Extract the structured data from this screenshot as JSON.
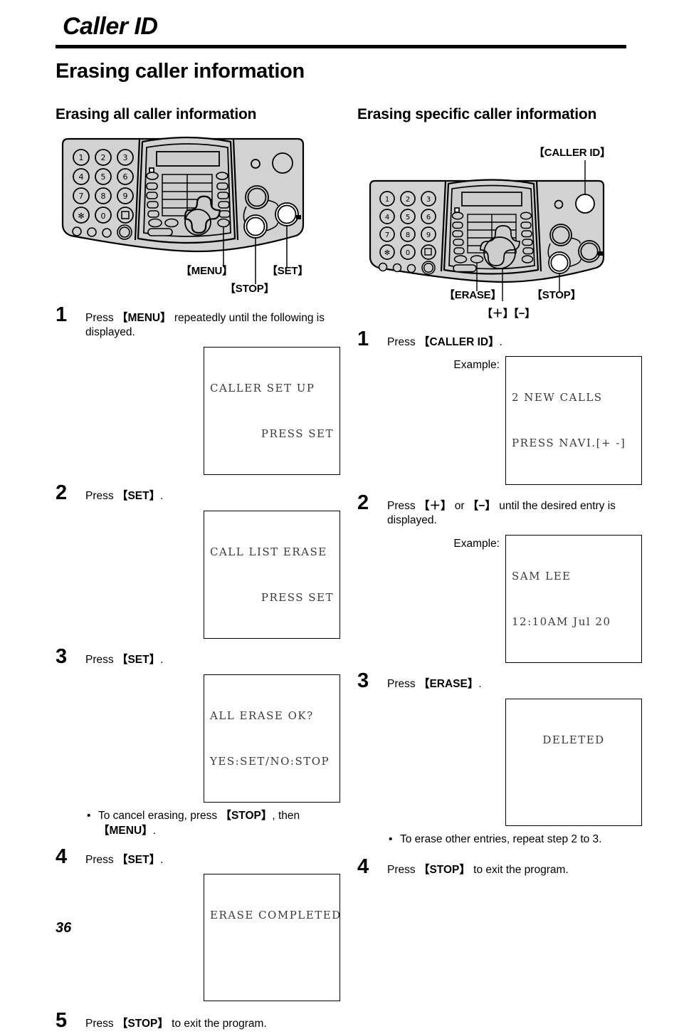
{
  "header": {
    "chapter_title": "Caller ID",
    "page_heading": "Erasing caller information"
  },
  "page_number": "36",
  "left_column": {
    "section_heading": "Erasing all caller information",
    "device_callouts": [
      {
        "name": "menu",
        "label": "【MENU】"
      },
      {
        "name": "set",
        "label": "【SET】"
      },
      {
        "name": "stop",
        "label": "【STOP】"
      }
    ],
    "steps": [
      {
        "num": "1",
        "text_parts": [
          "Press ",
          "【MENU】",
          " repeatedly until the following is displayed."
        ],
        "lcd": {
          "line1": "CALLER SET UP",
          "line2": "PRESS SET",
          "align2": "right"
        }
      },
      {
        "num": "2",
        "text_parts": [
          "Press ",
          "【SET】",
          "."
        ],
        "lcd": {
          "line1": "CALL LIST ERASE",
          "line2": "PRESS SET",
          "align2": "right"
        }
      },
      {
        "num": "3",
        "text_parts": [
          "Press ",
          "【SET】",
          "."
        ],
        "lcd": {
          "line1": "ALL ERASE OK?",
          "line2": "YES:SET/NO:STOP",
          "align2": "left"
        },
        "bullet": [
          "To cancel erasing, press ",
          "【STOP】",
          ", then ",
          "【MENU】",
          "."
        ]
      },
      {
        "num": "4",
        "text_parts": [
          "Press ",
          "【SET】",
          "."
        ],
        "lcd": {
          "line1": "ERASE COMPLETED",
          "line2": "",
          "align2": "left"
        }
      },
      {
        "num": "5",
        "text_parts": [
          "Press ",
          "【STOP】",
          " to exit the program."
        ]
      }
    ]
  },
  "right_column": {
    "section_heading": "Erasing specific caller information",
    "device_callouts": [
      {
        "name": "caller-id",
        "label": "【CALLER ID】"
      },
      {
        "name": "erase",
        "label": "【ERASE】"
      },
      {
        "name": "stop",
        "label": "【STOP】"
      },
      {
        "name": "plus-minus",
        "label": "【＋】【−】"
      }
    ],
    "steps": [
      {
        "num": "1",
        "text_parts": [
          "Press ",
          "【CALLER ID】",
          "."
        ],
        "example_label": "Example:",
        "lcd": {
          "line1": "2 NEW CALLS",
          "line2": "PRESS NAVI.[+ -]",
          "align2": "left"
        }
      },
      {
        "num": "2",
        "text_parts": [
          "Press ",
          "【＋】",
          " or ",
          "【−】",
          " until the desired entry is displayed."
        ],
        "example_label": "Example:",
        "lcd": {
          "line1": "SAM LEE",
          "line2": "12:10AM Jul 20",
          "align2": "left"
        }
      },
      {
        "num": "3",
        "text_parts": [
          "Press ",
          "【ERASE】",
          "."
        ],
        "lcd": {
          "line1": "DELETED",
          "line2": "",
          "align2": "center"
        },
        "bullet": [
          "To erase other entries, repeat step 2 to 3."
        ]
      },
      {
        "num": "4",
        "text_parts": [
          "Press ",
          "【STOP】",
          " to exit the program."
        ]
      }
    ]
  },
  "device": {
    "keypad_labels": [
      "1",
      "2",
      "3",
      "4",
      "5",
      "6",
      "7",
      "8",
      "9",
      "✳",
      "0",
      "⧉"
    ],
    "body_color": "#d2d2d2",
    "panel_color": "#cdcdcd",
    "outline_color": "#000000",
    "highlight_color": "#ffffff"
  }
}
